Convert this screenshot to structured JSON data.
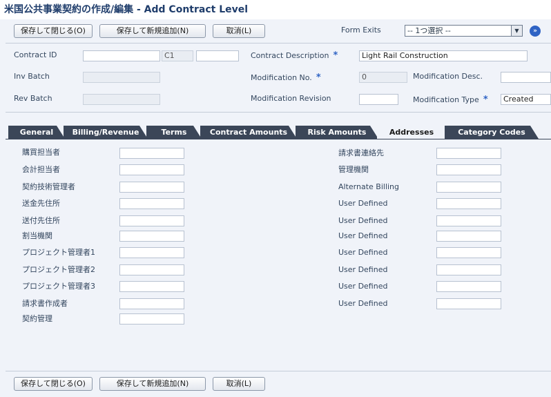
{
  "window": {
    "title": "米国公共事業契約の作成/編集 - Add Contract Level"
  },
  "toolbar": {
    "save_close": "保存して閉じる(O)",
    "save_new": "保存して新規追加(N)",
    "cancel": "取消(L)",
    "form_exits_label": "Form Exits",
    "form_exits_value": "-- 1つ選択 --"
  },
  "header_fields": {
    "contract_id_label": "Contract ID",
    "contract_id_value": "",
    "contract_type_value": "C1",
    "contract_company_value": "",
    "contract_desc_label": "Contract Description",
    "contract_desc_value": "Light Rail Construction",
    "inv_batch_label": "Inv Batch",
    "rev_batch_label": "Rev Batch",
    "mod_no_label": "Modification No.",
    "mod_no_value": "0",
    "mod_desc_label": "Modification Desc.",
    "mod_desc_value": "",
    "mod_revision_label": "Modification Revision",
    "mod_revision_value": "",
    "mod_type_label": "Modification Type",
    "mod_type_value": "Created"
  },
  "tabs": [
    {
      "label": "General"
    },
    {
      "label": "Billing/Revenue"
    },
    {
      "label": "Terms"
    },
    {
      "label": "Contract Amounts"
    },
    {
      "label": "Risk Amounts"
    },
    {
      "label": "Addresses"
    },
    {
      "label": "Category Codes"
    }
  ],
  "addresses": {
    "left": [
      {
        "label": "購買担当者",
        "value": ""
      },
      {
        "label": "会計担当者",
        "value": ""
      },
      {
        "label": "契約技術管理者",
        "value": ""
      },
      {
        "label": "送金先住所",
        "value": ""
      },
      {
        "label": "送付先住所",
        "value": ""
      },
      {
        "label": "割当機関",
        "value": ""
      },
      {
        "label": "プロジェクト管理者1",
        "value": ""
      },
      {
        "label": "プロジェクト管理者2",
        "value": ""
      },
      {
        "label": "プロジェクト管理者3",
        "value": ""
      },
      {
        "label": "請求書作成者",
        "value": ""
      },
      {
        "label": "契約管理",
        "value": ""
      }
    ],
    "right": [
      {
        "label": "請求書連絡先",
        "value": ""
      },
      {
        "label": "管理機関",
        "value": ""
      },
      {
        "label": "Alternate Billing",
        "value": ""
      },
      {
        "label": "User Defined",
        "value": ""
      },
      {
        "label": "User Defined",
        "value": ""
      },
      {
        "label": "User Defined",
        "value": ""
      },
      {
        "label": "User Defined",
        "value": ""
      },
      {
        "label": "User Defined",
        "value": ""
      },
      {
        "label": "User Defined",
        "value": ""
      },
      {
        "label": "User Defined",
        "value": ""
      }
    ]
  }
}
